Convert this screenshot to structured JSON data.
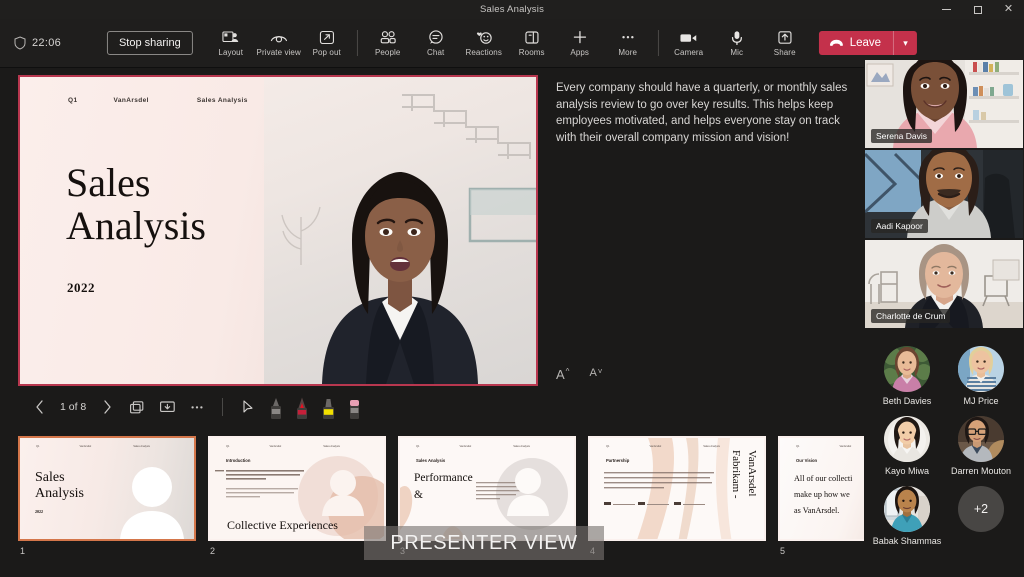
{
  "window": {
    "title": "Sales Analysis",
    "minimize_label": "Minimize",
    "maximize_label": "Maximize",
    "close_label": "Close"
  },
  "toolbar": {
    "timer": "22:06",
    "shield_icon": "shield-icon",
    "stop_sharing_label": "Stop sharing",
    "items": [
      {
        "label": "Layout",
        "icon": "layout-icon"
      },
      {
        "label": "Private view",
        "icon": "eye-icon"
      },
      {
        "label": "Pop out",
        "icon": "pop-out-icon"
      },
      {
        "label": "People",
        "icon": "people-icon"
      },
      {
        "label": "Chat",
        "icon": "chat-icon"
      },
      {
        "label": "Reactions",
        "icon": "reactions-icon"
      },
      {
        "label": "Rooms",
        "icon": "rooms-icon"
      },
      {
        "label": "Apps",
        "icon": "plus-icon"
      },
      {
        "label": "More",
        "icon": "ellipsis-icon"
      },
      {
        "label": "Camera",
        "icon": "camera-icon"
      },
      {
        "label": "Mic",
        "icon": "mic-icon"
      },
      {
        "label": "Share",
        "icon": "share-icon"
      }
    ],
    "leave_label": "Leave",
    "leave_color": "#c4314b"
  },
  "slide": {
    "header": [
      "Q1",
      "VanArsdel",
      "Sales Analysis"
    ],
    "title_line1": "Sales",
    "title_line2": "Analysis",
    "year": "2022",
    "border_color": "#b8374f"
  },
  "slide_controls": {
    "previous_label": "Previous slide",
    "next_label": "Next slide",
    "counter": "1 of 8",
    "grid_label": "All slides",
    "present_label": "Present in window",
    "more_label": "More options",
    "pointer_label": "Laser pointer",
    "pen_black_label": "Black pen",
    "pen_red_label": "Red pen",
    "highlighter_label": "Yellow highlighter",
    "eraser_label": "Eraser"
  },
  "notes": {
    "text": "Every company should have a quarterly, or monthly sales analysis review to go over key results. This helps keep employees motivated, and helps everyone stay on track with their overall company mission and vision!",
    "increase_font_label": "A",
    "decrease_font_label": "A"
  },
  "participants": {
    "video_tiles": [
      {
        "name": "Serena Davis"
      },
      {
        "name": "Aadi Kapoor"
      },
      {
        "name": "Charlotte de Crum"
      }
    ],
    "avatars": [
      {
        "name": "Beth Davies"
      },
      {
        "name": "MJ Price"
      },
      {
        "name": "Kayo Miwa"
      },
      {
        "name": "Darren Mouton"
      },
      {
        "name": "Babak Shammas"
      }
    ],
    "overflow_label": "+2"
  },
  "filmstrip": {
    "watermark": "PRESENTER VIEW",
    "slides": [
      {
        "number": "1",
        "selected": true,
        "header": [
          "Q1",
          "VanArsdel",
          "Sales Analysis"
        ],
        "kicker": "",
        "title_line1": "Sales",
        "title_line2": "Analysis",
        "year": "2022"
      },
      {
        "number": "2",
        "selected": false,
        "header": [
          "Q1",
          "VanArsdel",
          "Sales Analysis"
        ],
        "kicker": "Introduction",
        "big_text": "Collective Experiences"
      },
      {
        "number": "3",
        "selected": false,
        "header": [
          "Q1",
          "VanArsdel",
          "Sales Analysis"
        ],
        "kicker": "Sales Analysis",
        "title_line1": "Performance",
        "title_line2": "&"
      },
      {
        "number": "4",
        "selected": false,
        "header": [
          "Q1",
          "VanArsdel",
          "Sales Analysis"
        ],
        "kicker": "Partnership",
        "vertical_line1": "Fabrikam -",
        "vertical_line2": "VanArsdel"
      },
      {
        "number": "5",
        "selected": false,
        "header": [
          "Q1",
          "VanArsdel"
        ],
        "kicker": "Our Vision",
        "body_line1": "All of our collecti",
        "body_line2": "make up how we",
        "body_line3": "as VanArsdel."
      }
    ]
  }
}
